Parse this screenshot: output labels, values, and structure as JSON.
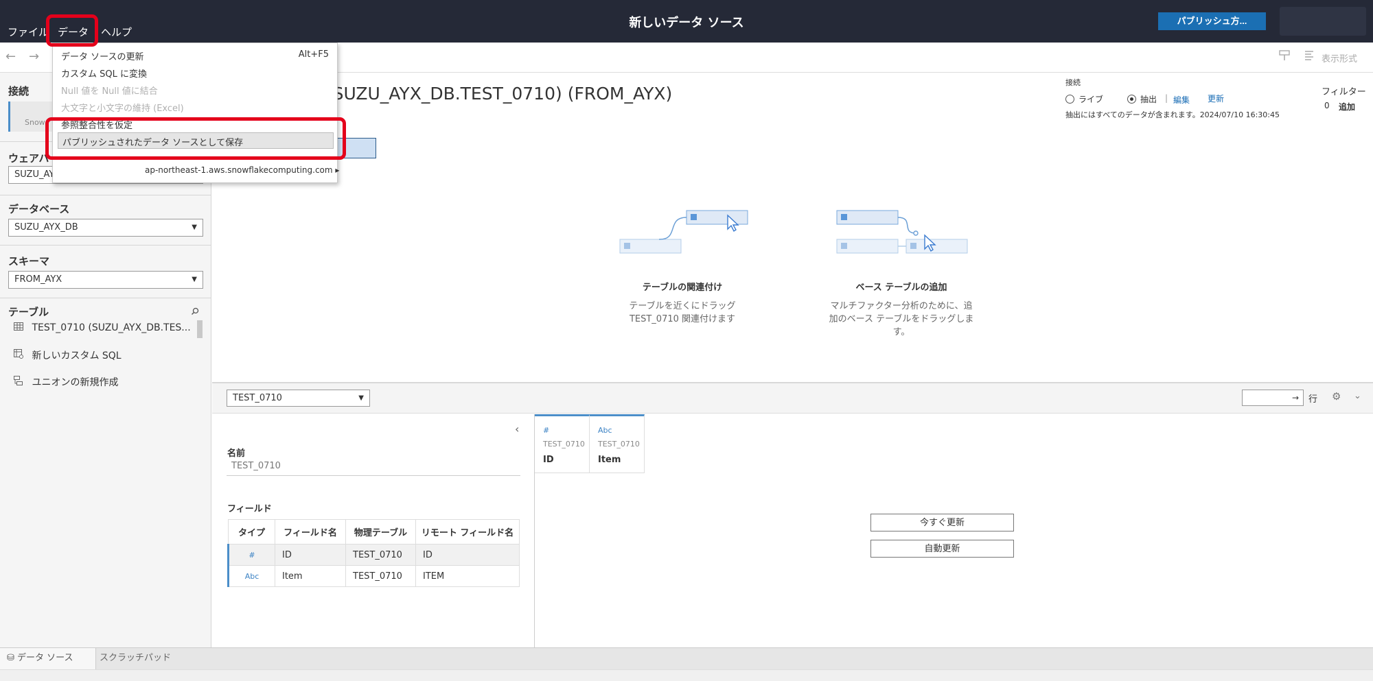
{
  "header": {
    "menus": [
      "ファイル",
      "データ",
      "ヘルプ"
    ],
    "title": "新しいデータ ソース",
    "publish_label": "パブリッシュ方..."
  },
  "toolbar": {
    "format_label": "表示形式",
    "icons": [
      "back-arrow-icon",
      "forward-arrow-icon",
      "paint-icon",
      "format-icon"
    ]
  },
  "dropdown": {
    "refresh_label": "データ ソースの更新",
    "refresh_shortcut": "Alt+F5",
    "custom_sql_label": "カスタム SQL に変換",
    "null_label": "Null 値を Null 値に結合",
    "case_label": "大文字と小文字の維持 (Excel)",
    "ref_label": "参照整合性を仮定",
    "publish_label": "パブリッシュされたデータ ソースとして保存",
    "server_label": "ap-northeast-1.aws.snowflakecomputing.com"
  },
  "sidebar": {
    "connection_title": "接続",
    "connection_sub": "Snow",
    "warehouse_title": "ウェアハ",
    "warehouse_value": "SUZU_AY",
    "database_title": "データベース",
    "database_value": "SUZU_AYX_DB",
    "schema_title": "スキーマ",
    "schema_value": "FROM_AYX",
    "table_title": "テーブル",
    "items": [
      {
        "label": "TEST_0710 (SUZU_AYX_DB.TES...",
        "icon": "table-icon"
      },
      {
        "label": "新しいカスタム SQL",
        "icon": "custom-sql-icon"
      },
      {
        "label": "ユニオンの新規作成",
        "icon": "union-icon"
      }
    ]
  },
  "datasource": {
    "title": "0 (SUZU_AYX_DB.TEST_0710) (FROM_AYX)"
  },
  "connection_opts": {
    "label": "接続",
    "live": "ライブ",
    "extract": "抽出",
    "sep": "|",
    "edit": "編集",
    "refresh": "更新",
    "extract_note": "抽出にはすべてのデータが含まれます。2024/07/10 16:30:45",
    "filter_label": "フィルター",
    "filter_count": "0",
    "filter_add": "追加",
    "selected": "extract"
  },
  "illustrations": [
    {
      "title": "テーブルの関連付け",
      "desc1": "テーブルを近くにドラッグ",
      "desc2": "TEST_0710 関連付けます",
      "desc3": ""
    },
    {
      "title": "ベース テーブルの追加",
      "desc1": "マルチファクター分析のために、追",
      "desc2": "加のベース テーブルをドラッグしま",
      "desc3": "す。"
    }
  ],
  "lower": {
    "table_select": "TEST_0710",
    "rows_label": "行",
    "rows_arrow": "→",
    "name_label": "名前",
    "name_value": "TEST_0710",
    "fields_label": "フィールド",
    "headers": [
      "タイプ",
      "フィールド名",
      "物理テーブル",
      "リモート フィールド名"
    ],
    "rows": [
      {
        "type": "#",
        "name": "ID",
        "table": "TEST_0710",
        "remote": "ID"
      },
      {
        "type": "Abc",
        "name": "Item",
        "table": "TEST_0710",
        "remote": "ITEM"
      }
    ],
    "columns": [
      {
        "type": "#",
        "source": "TEST_0710",
        "name": "ID"
      },
      {
        "type": "Abc",
        "source": "TEST_0710",
        "name": "Item"
      }
    ],
    "update_now": "今すぐ更新",
    "auto_update": "自動更新"
  },
  "bottom_tabs": [
    "データ ソース",
    "スクラッチパッド"
  ],
  "colors": {
    "accent": "#1b6fb3",
    "highlight": "#e4001b",
    "topbar": "#252937"
  }
}
